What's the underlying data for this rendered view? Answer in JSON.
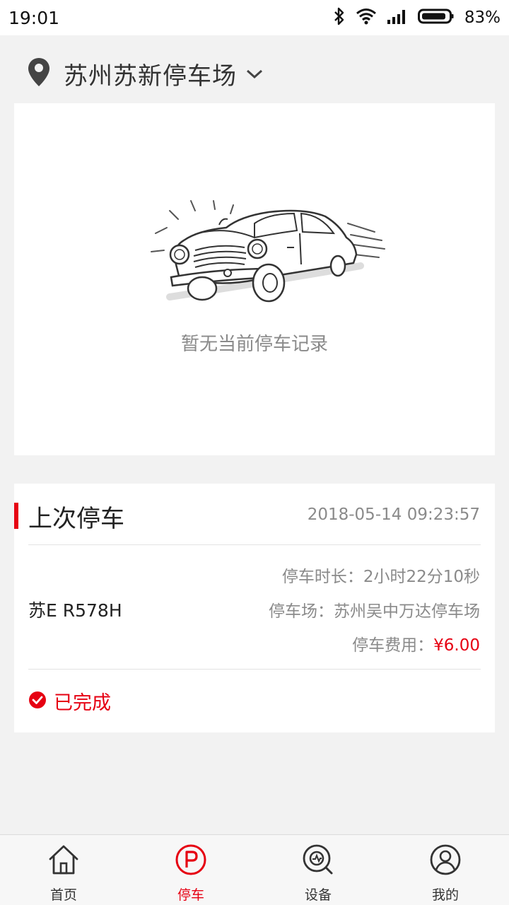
{
  "status_bar": {
    "time": "19:01",
    "battery": "83%",
    "icons": [
      "bluetooth-icon",
      "wifi-icon",
      "signal-icon",
      "battery-icon"
    ]
  },
  "location": {
    "name": "苏州苏新停车场",
    "icon": "location-pin-icon",
    "dropdown_icon": "chevron-down-icon"
  },
  "current_parking": {
    "empty_text": "暂无当前停车记录",
    "illustration": "car-illustration"
  },
  "last_parking": {
    "title": "上次停车",
    "time": "2018-05-14 09:23:57",
    "plate": "苏E R578H",
    "duration_label": "停车时长：",
    "duration_value": "2小时22分10秒",
    "lot_label": "停车场：",
    "lot_value": "苏州吴中万达停车场",
    "fee_label": "停车费用：",
    "fee_value": "¥6.00",
    "status": "已完成"
  },
  "nav": {
    "items": [
      {
        "label": "首页",
        "icon": "home-icon"
      },
      {
        "label": "停车",
        "icon": "parking-icon"
      },
      {
        "label": "设备",
        "icon": "device-icon"
      },
      {
        "label": "我的",
        "icon": "profile-icon"
      }
    ],
    "active": "停车"
  },
  "colors": {
    "accent": "#e60012",
    "background": "#f2f2f2",
    "muted_text": "#8a8a8a"
  }
}
